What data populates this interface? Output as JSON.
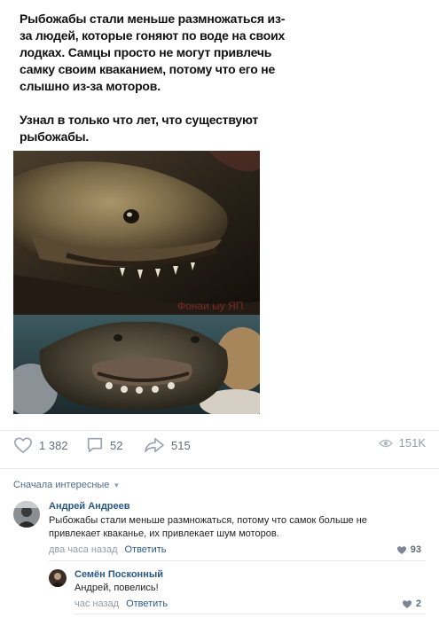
{
  "post": {
    "paragraph1": "Рыбожабы стали меньше размножаться из-за людей, которые гоняют по воде на своих лодках. Самцы просто не могут привлечь самку своим кваканием, потому что его не слышно из-за моторов.",
    "paragraph2": "Узнал в только что лет, что существуют рыбожабы.",
    "watermark": "Фонаи ыу ЯП"
  },
  "actions": {
    "likes": "1 382",
    "comments": "52",
    "shares": "515",
    "views": "151K"
  },
  "comments_sort": "Сначала интересные",
  "comments": [
    {
      "author": "Андрей Андреев",
      "text": "Рыбожабы стали меньше размножаться, потому что самок больше не привлекает кваканье, их привлекает шум моторов.",
      "time": "два часа назад",
      "reply_label": "Ответить",
      "likes": "93"
    },
    {
      "author": "Семён Посконный",
      "text": "Андрей, повелись!",
      "time": "час назад",
      "reply_label": "Ответить",
      "likes": "2"
    }
  ],
  "colors": {
    "link": "#2a5885",
    "meta": "#939ba5",
    "icon": "#626d7a",
    "divider": "#e7e8ec"
  }
}
